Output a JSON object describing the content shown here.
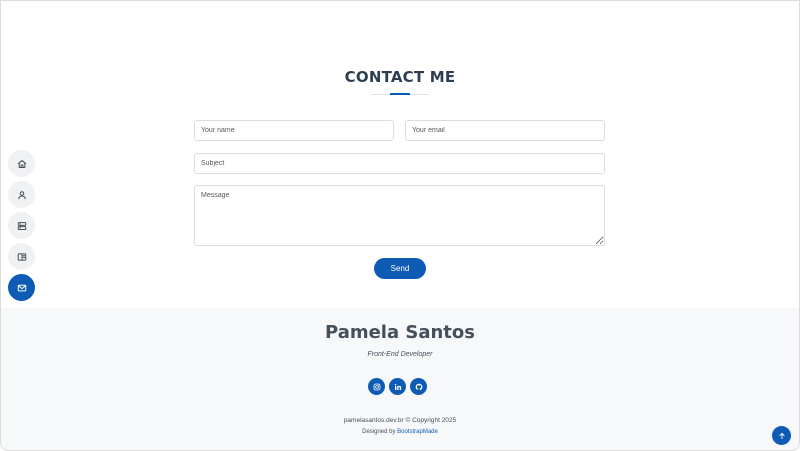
{
  "nav": {
    "items": [
      {
        "icon": "home-icon",
        "active": false
      },
      {
        "icon": "person-icon",
        "active": false
      },
      {
        "icon": "server-icon",
        "active": false
      },
      {
        "icon": "book-icon",
        "active": false
      },
      {
        "icon": "envelope-icon",
        "active": true
      }
    ]
  },
  "contact": {
    "title": "CONTACT ME",
    "name_placeholder": "Your name",
    "email_placeholder": "Your email",
    "subject_placeholder": "Subject",
    "message_placeholder": "Message",
    "send_label": "Send"
  },
  "footer": {
    "name": "Pamela Santos",
    "role": "Front-End Developer",
    "socials": [
      "instagram-icon",
      "linkedin-icon",
      "github-icon"
    ],
    "copyright": "pamelasantos.dev.br © Copyright 2025",
    "designed_by_prefix": "Designed by ",
    "designed_by_link": "BootstrapMade"
  },
  "colors": {
    "accent": "#0d5bb5",
    "footer_bg": "#f7f8f9",
    "nav_bg": "#f0f1f3",
    "heading": "#2c3e50"
  }
}
